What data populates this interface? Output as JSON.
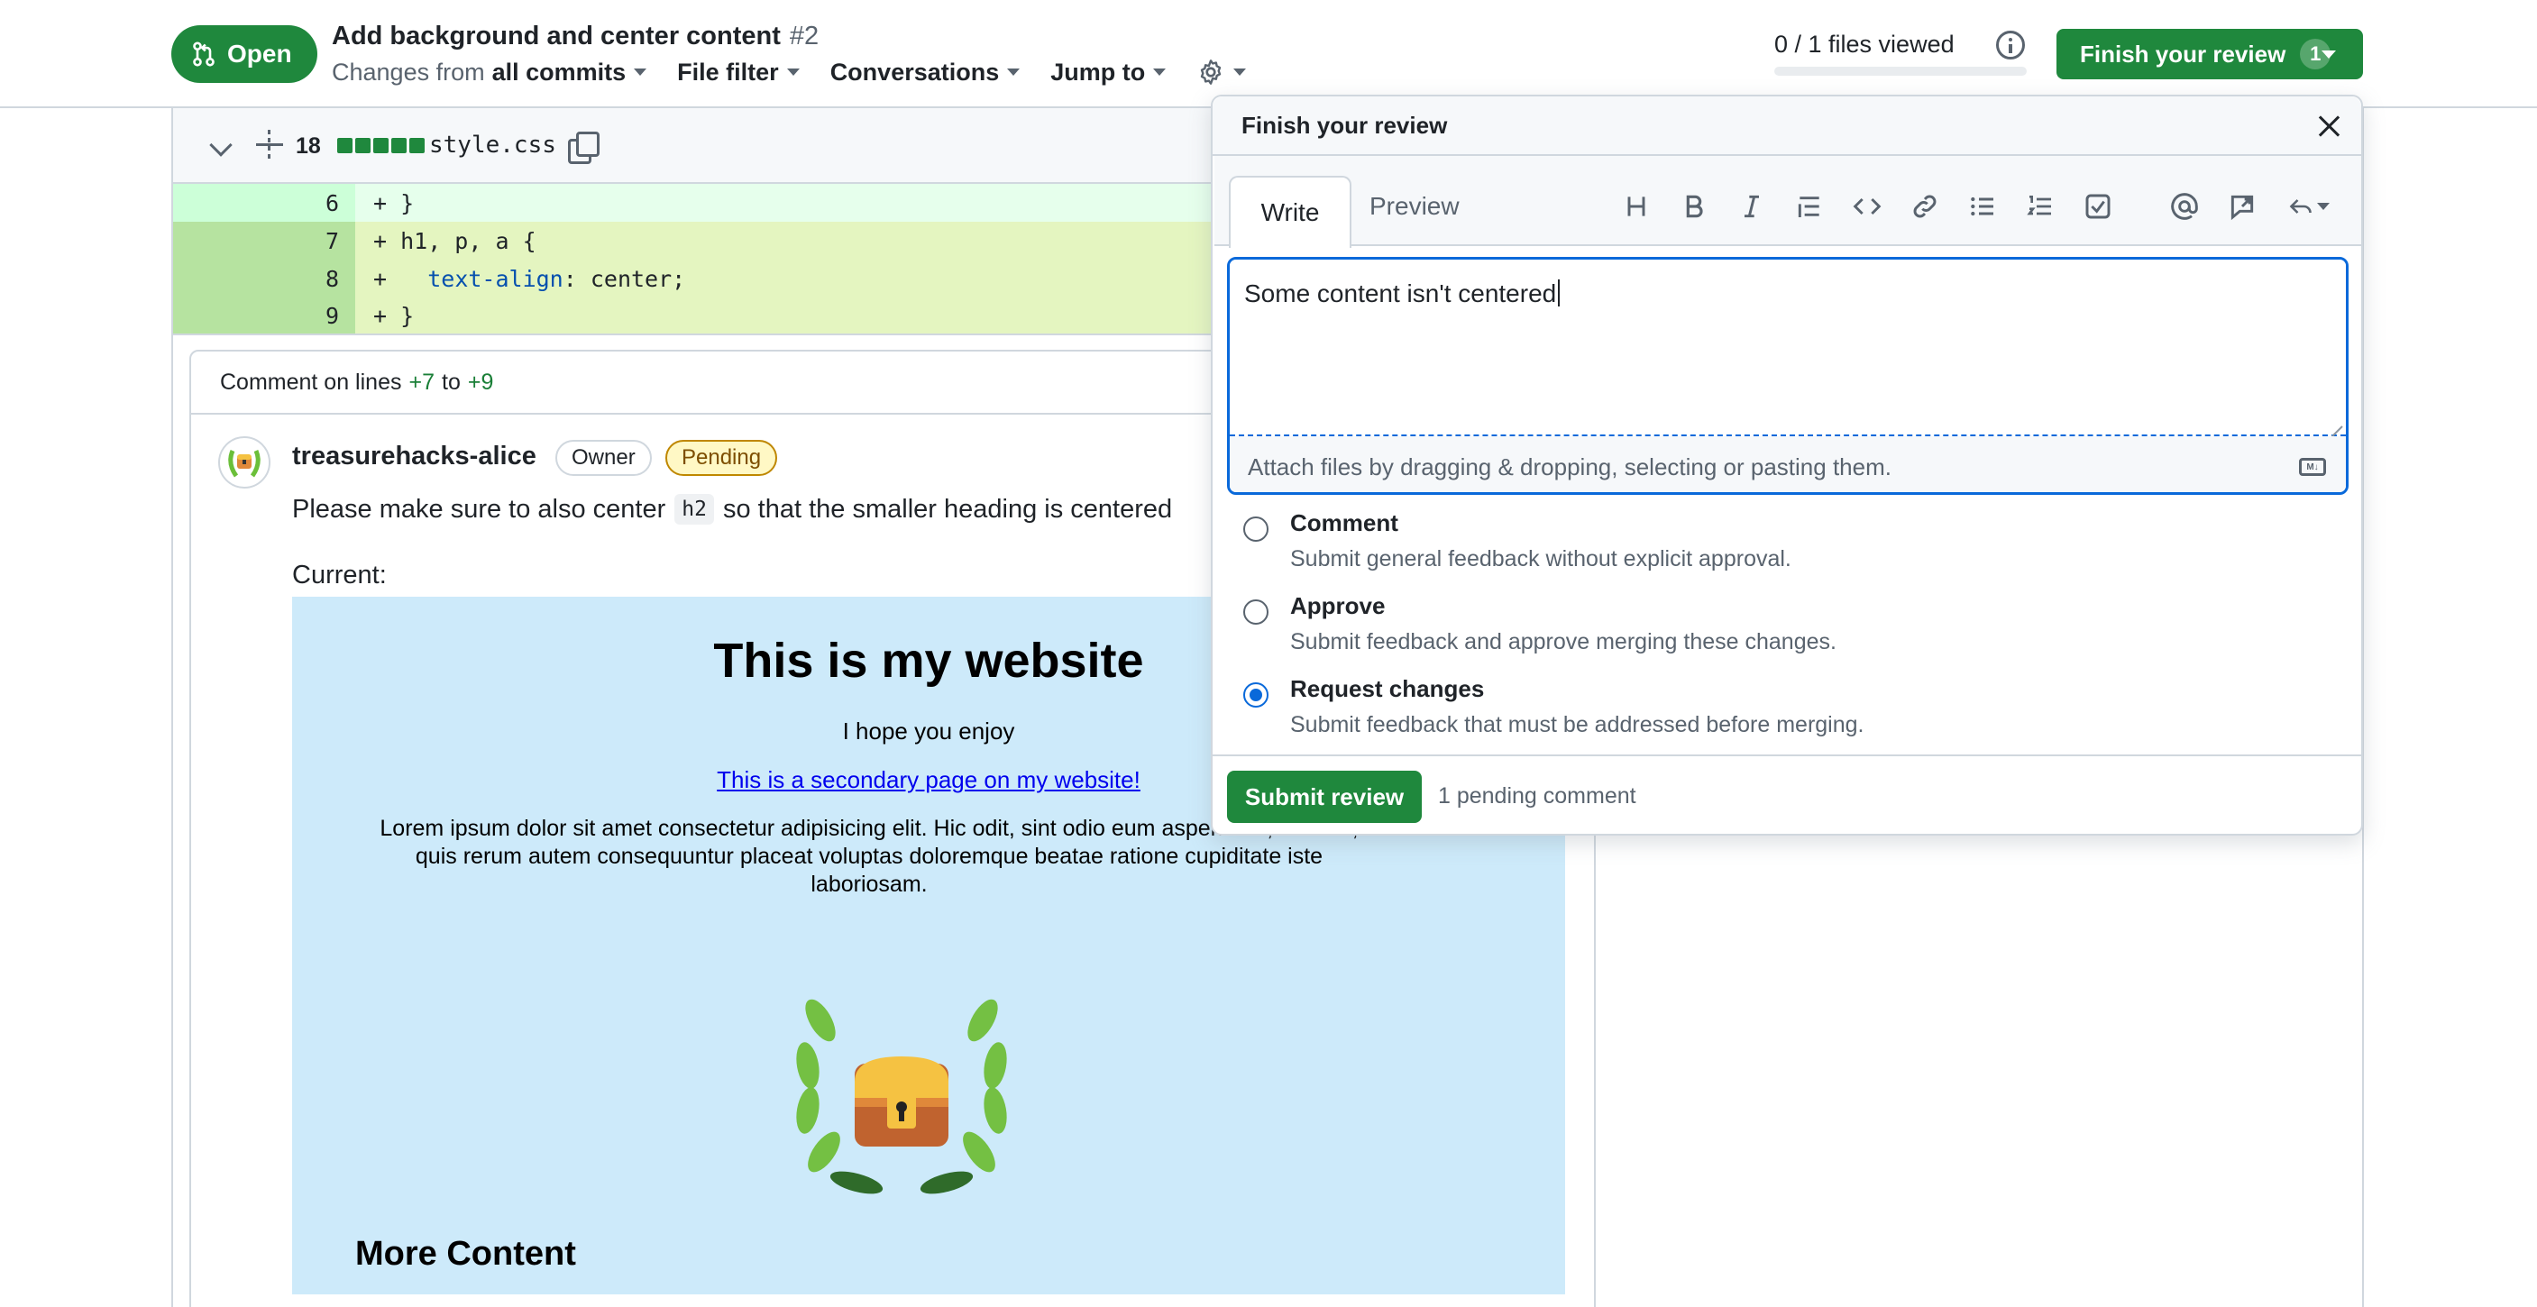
{
  "header": {
    "status_label": "Open",
    "pr_title": "Add background and center content",
    "pr_number": "#2",
    "changes_prefix": "Changes from",
    "changes_value": "all commits",
    "file_filter": "File filter",
    "conversations": "Conversations",
    "jump_to": "Jump to",
    "files_viewed": "0 / 1 files viewed",
    "files_viewed_fraction": 0,
    "finish_review": "Finish your review",
    "finish_review_count": "1"
  },
  "file": {
    "diffstat": "18",
    "filename": "style.css",
    "lines": [
      {
        "num": "6",
        "code": "+ }"
      },
      {
        "num": "7",
        "code": "+ h1, p, a {"
      },
      {
        "num": "8",
        "prefix": "+   ",
        "prop": "text-align",
        "rest": ": center;"
      },
      {
        "num": "9",
        "code": "+ }"
      }
    ]
  },
  "thread": {
    "head_prefix": "Comment on lines",
    "line_start": "+7",
    "head_to": "to",
    "line_end": "+9",
    "author": "treasurehacks-alice",
    "owner_badge": "Owner",
    "pending_badge": "Pending",
    "text_before": "Please make sure to also center",
    "code": "h2",
    "text_after": "so that the smaller heading is centered",
    "current_label": "Current:",
    "preview": {
      "h1": "This is my website",
      "p1": "I hope you enjoy",
      "link": "This is a secondary page on my website!",
      "lorem": "Lorem ipsum dolor sit amet consectetur adipisicing elit. Hic odit, sint odio eum asperiores, veniam, quis rerum autem consequuntur placeat voluptas doloremque beatae ratione cupiditate iste laboriosam.",
      "h2": "More Content"
    }
  },
  "review": {
    "title": "Finish your review",
    "tab_write": "Write",
    "tab_preview": "Preview",
    "toolbar_icons": [
      "heading-icon",
      "bold-icon",
      "italic-icon",
      "quote-icon",
      "code-icon",
      "link-icon",
      "unordered-list-icon",
      "ordered-list-icon",
      "task-list-icon",
      "mention-icon",
      "reference-icon",
      "reply-icon"
    ],
    "body": "Some content isn't centered",
    "attach_hint": "Attach files by dragging & dropping, selecting or pasting them.",
    "options": [
      {
        "label": "Comment",
        "desc": "Submit general feedback without explicit approval.",
        "checked": false
      },
      {
        "label": "Approve",
        "desc": "Submit feedback and approve merging these changes.",
        "checked": false
      },
      {
        "label": "Request changes",
        "desc": "Submit feedback that must be addressed before merging.",
        "checked": true
      }
    ],
    "submit": "Submit review",
    "pending": "1 pending comment"
  },
  "colors": {
    "accent_green": "#1f883d",
    "focus_blue": "#0969da",
    "preview_bg": "#cdeafa"
  }
}
